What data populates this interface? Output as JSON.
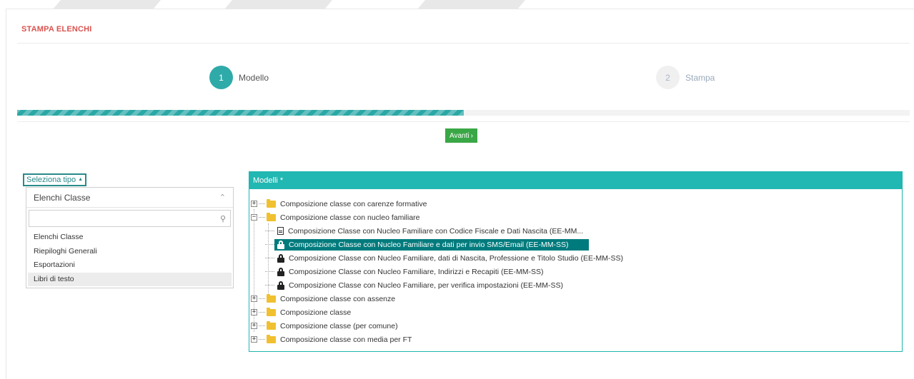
{
  "page": {
    "title": "STAMPA ELENCHI"
  },
  "wizard": {
    "steps": [
      {
        "number": "1",
        "label": "Modello",
        "active": true
      },
      {
        "number": "2",
        "label": "Stampa",
        "active": false
      }
    ],
    "progress_fraction": 0.5,
    "next_button": "Avanti"
  },
  "type_select": {
    "label": "Seleziona tipo",
    "required_mark": "*",
    "selected": "Elenchi Classe",
    "search_value": "",
    "options": [
      "Elenchi Classe",
      "Riepiloghi Generali",
      "Esportazioni",
      "Libri di testo"
    ],
    "hovered_option": "Libri di testo"
  },
  "models": {
    "header": "Modelli *",
    "tree": [
      {
        "label": "Composizione classe con carenze formative",
        "expanded": false
      },
      {
        "label": "Composizione classe con nucleo familiare",
        "expanded": true,
        "children": [
          {
            "label": "Composizione Classe con Nucleo Familiare con Codice Fiscale e Dati Nascita (EE-MM...",
            "icon": "document-icon"
          },
          {
            "label": "Composizione Classe con Nucleo Familiare e dati per invio SMS/Email (EE-MM-SS)",
            "icon": "lock-icon",
            "selected": true
          },
          {
            "label": "Composizione Classe con Nucleo Familiare, dati di Nascita, Professione e Titolo Studio (EE-MM-SS)",
            "icon": "lock-icon"
          },
          {
            "label": "Composizione Classe con Nucleo Familiare, Indirizzi e Recapiti (EE-MM-SS)",
            "icon": "lock-icon"
          },
          {
            "label": "Composizione Classe con Nucleo Familiare, per verifica impostazioni (EE-MM-SS)",
            "icon": "lock-icon"
          }
        ]
      },
      {
        "label": "Composizione classe con assenze",
        "expanded": false
      },
      {
        "label": "Composizione classe",
        "expanded": false
      },
      {
        "label": "Composizione classe (per comune)",
        "expanded": false
      },
      {
        "label": "Composizione classe con media per FT",
        "expanded": false
      }
    ]
  },
  "colors": {
    "accent": "#21b7b2",
    "title_red": "#d9534f",
    "next_green": "#3aa746",
    "selected_row": "#007b7d"
  }
}
